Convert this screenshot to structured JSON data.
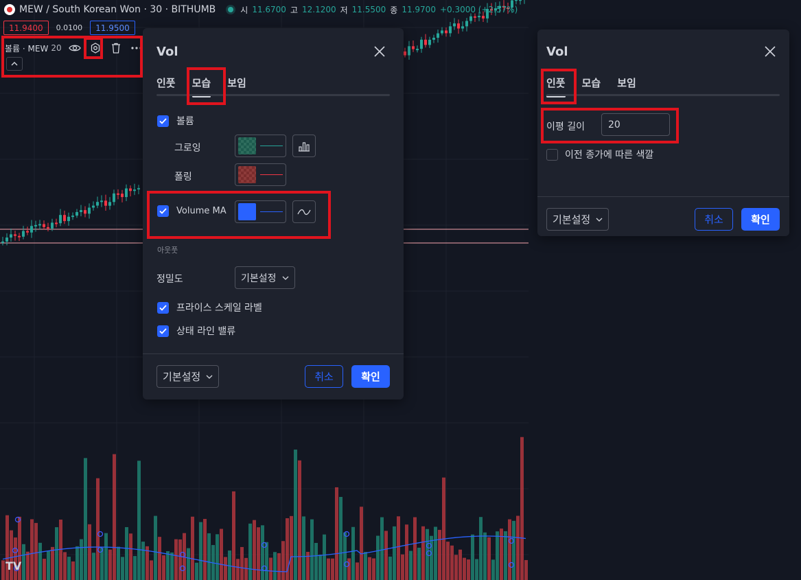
{
  "header": {
    "symbol_title": "MEW / South Korean Won · 30 · BITHUMB",
    "ohlc": [
      {
        "label": "시",
        "value": "11.6700"
      },
      {
        "label": "고",
        "value": "12.1200"
      },
      {
        "label": "저",
        "value": "11.5500"
      },
      {
        "label": "종",
        "value": "11.9700"
      }
    ],
    "change": "+0.3000 (+2.57%)",
    "sell_price": "11.9400",
    "spread": "0.0100",
    "buy_price": "11.9500"
  },
  "indicator_legend": {
    "name": "볼륨 · MEW",
    "length": "20",
    "icons": [
      "eye-icon",
      "gear-icon",
      "trash-icon",
      "more-icon"
    ],
    "collapse_icon": "chevron-up-icon"
  },
  "style_dialog": {
    "title": "Vol",
    "tabs": [
      "인풋",
      "모습",
      "보임"
    ],
    "active_tab": "모습",
    "volume_label": "볼륨",
    "growing_label": "그로잉",
    "falling_label": "폴링",
    "volume_ma_label": "Volume MA",
    "output_section": "아웃풋",
    "precision_label": "정밀도",
    "precision_value": "기본설정",
    "price_scale_label": "프라이스 스케일 라벨",
    "status_line_label": "상태 라인 밸류",
    "defaults_label": "기본설정",
    "cancel_label": "취소",
    "ok_label": "확인",
    "colors": {
      "growing": "#26a69a",
      "falling": "#f23645",
      "ma": "#2962ff"
    }
  },
  "inputs_dialog": {
    "title": "Vol",
    "tabs": [
      "인풋",
      "모습",
      "보임"
    ],
    "active_tab": "인풋",
    "ma_length_label": "이평 길이",
    "ma_length_value": "20",
    "color_prev_close_label": "이전 종가에 따른 색깔",
    "defaults_label": "기본설정",
    "cancel_label": "취소",
    "ok_label": "확인"
  },
  "branding": {
    "watermark": "TV"
  },
  "colors": {
    "up": "#26a69a",
    "down": "#f23645",
    "accent": "#2962ff",
    "highlight": "#e0141e"
  }
}
